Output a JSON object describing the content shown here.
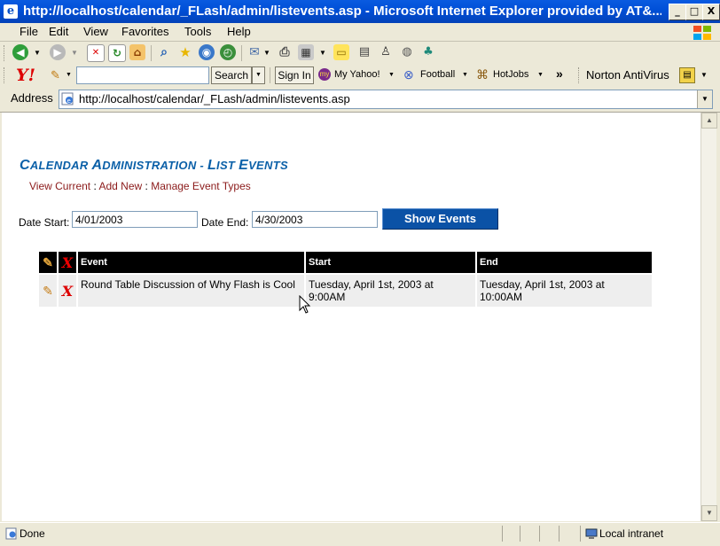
{
  "window": {
    "title": "http://localhost/calendar/_FLash/admin/listevents.asp - Microsoft Internet Explorer provided by AT&...",
    "controls": {
      "minimize": "_",
      "maximize": "□",
      "close": "X"
    }
  },
  "menu": [
    "File",
    "Edit",
    "View",
    "Favorites",
    "Tools",
    "Help"
  ],
  "yahoo_toolbar": {
    "search_value": "",
    "search_button": "Search",
    "sign_in": "Sign In",
    "my_yahoo": "My Yahoo!",
    "football": "Football",
    "hotjobs": "HotJobs",
    "more": "»",
    "norton": "Norton AntiVirus"
  },
  "address": {
    "label": "Address",
    "url": "http://localhost/calendar/_FLash/admin/listevents.asp"
  },
  "page": {
    "heading_prefix": "C",
    "heading_1": "ALENDAR ",
    "heading_2": "A",
    "heading_3": "DMINISTRATION - ",
    "heading_4": "L",
    "heading_5": "IST ",
    "heading_6": "E",
    "heading_7": "VENTS",
    "nav": {
      "view_current": "View Current",
      "add_new": "Add New",
      "manage_types": "Manage Event Types",
      "separator": ":"
    },
    "filter": {
      "date_start_label": "Date Start:",
      "date_start_value": "4/01/2003",
      "date_end_label": "Date End:",
      "date_end_value": "4/30/2003",
      "show_button": "Show Events"
    },
    "table": {
      "headers": [
        "Event",
        "Start",
        "End"
      ],
      "rows": [
        {
          "event": "Round Table Discussion of Why Flash is Cool",
          "start": "Tuesday, April 1st, 2003 at 9:00AM",
          "end": "Tuesday, April 1st, 2003 at 10:00AM"
        }
      ]
    }
  },
  "status": {
    "text": "Done",
    "zone": "Local intranet"
  }
}
